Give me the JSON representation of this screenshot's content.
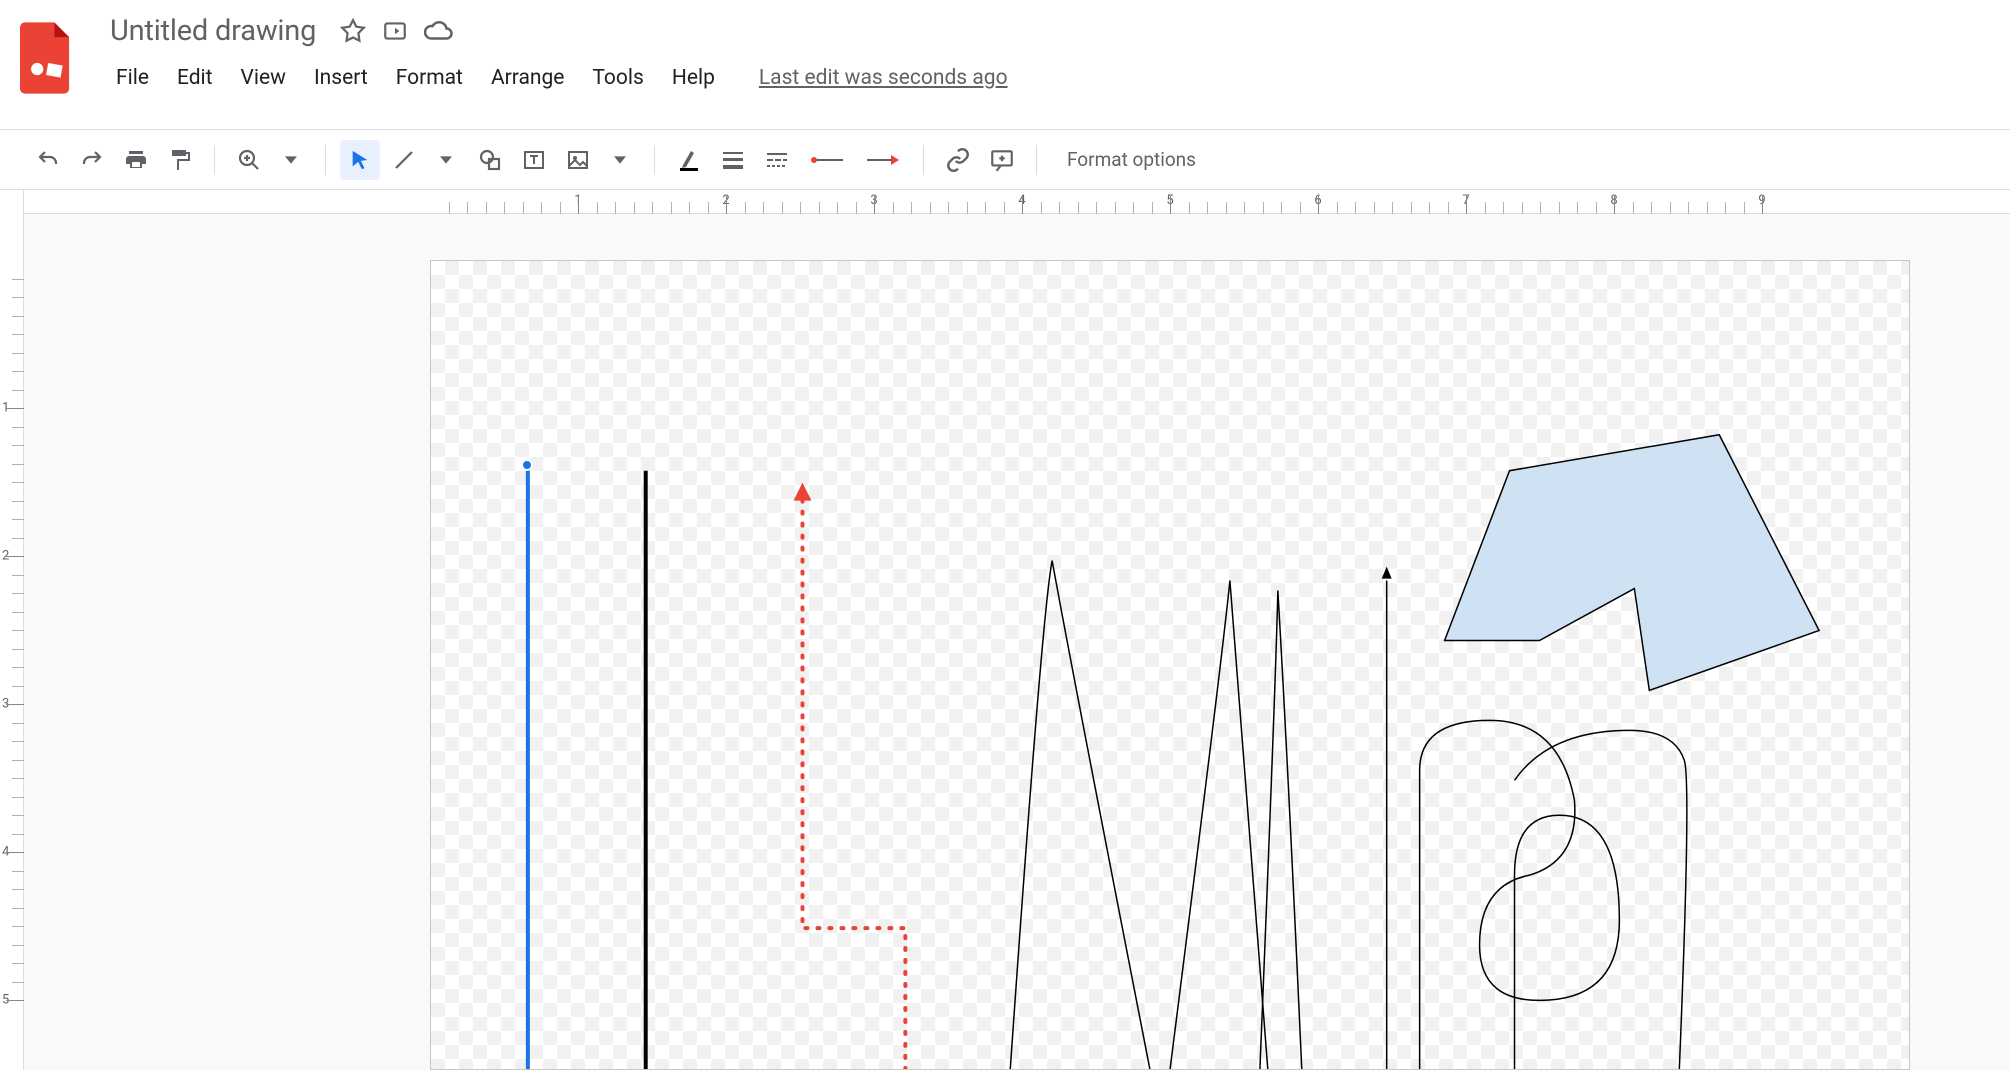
{
  "header": {
    "title": "Untitled drawing",
    "menus": [
      "File",
      "Edit",
      "View",
      "Insert",
      "Format",
      "Arrange",
      "Tools",
      "Help"
    ],
    "last_edit": "Last edit was seconds ago"
  },
  "toolbar": {
    "format_options": "Format options"
  },
  "ruler_h": [
    "1",
    "2",
    "3",
    "4",
    "5",
    "6",
    "7",
    "8",
    "9"
  ],
  "ruler_v": [
    "1",
    "2",
    "3",
    "4",
    "5"
  ]
}
